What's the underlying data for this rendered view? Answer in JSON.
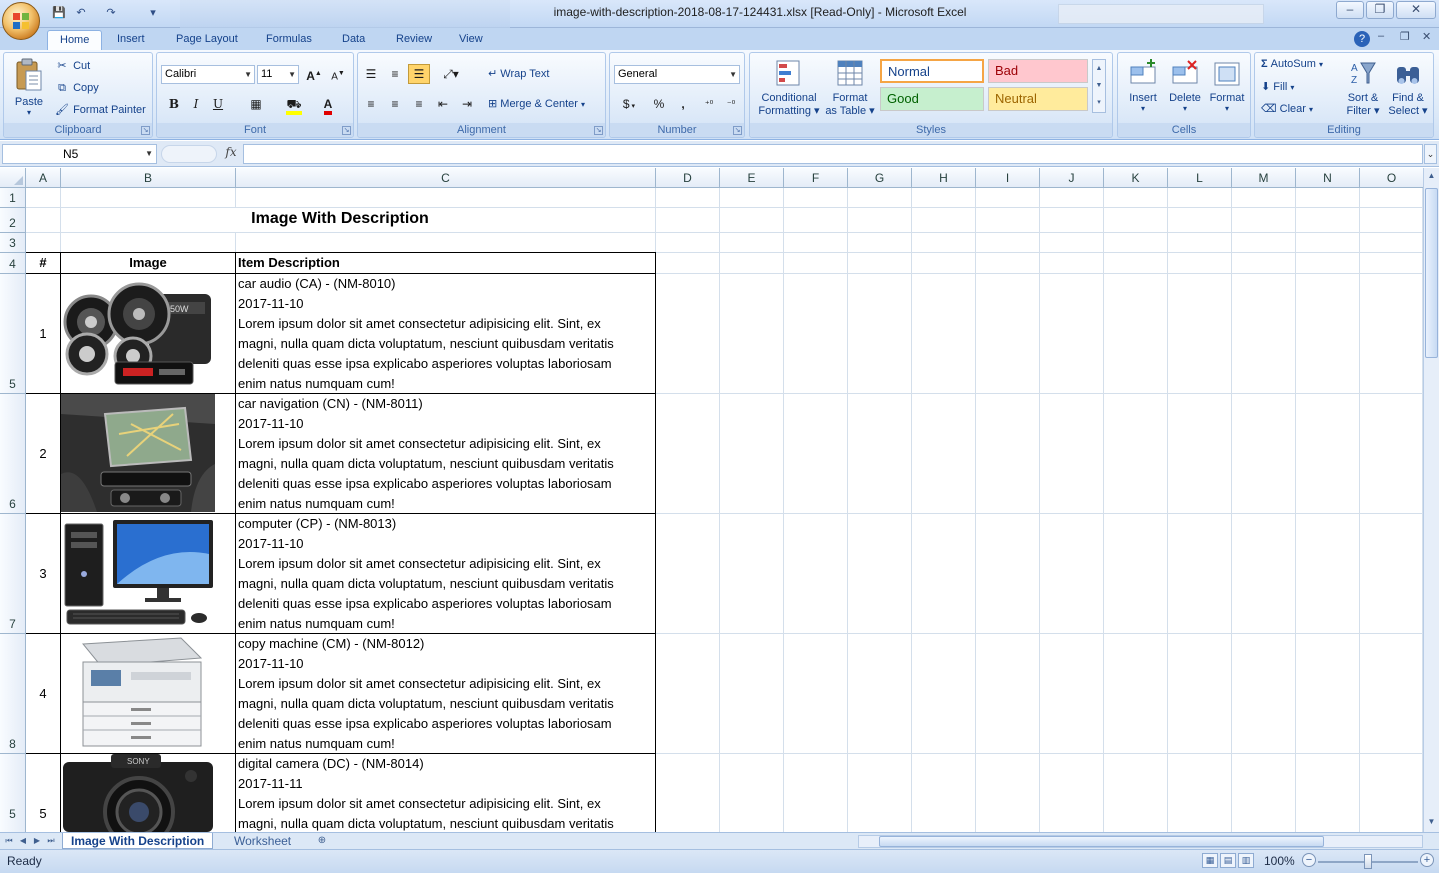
{
  "window": {
    "title": "image-with-description-2018-08-17-124431.xlsx  [Read-Only]  - Microsoft Excel",
    "minimize": "–",
    "restore": "❐",
    "close": "✕"
  },
  "ribbon_tabs": [
    "Home",
    "Insert",
    "Page Layout",
    "Formulas",
    "Data",
    "Review",
    "View"
  ],
  "clipboard": {
    "paste": "Paste",
    "cut": "Cut",
    "copy": "Copy",
    "format_painter": "Format Painter",
    "label": "Clipboard"
  },
  "font": {
    "name": "Calibri",
    "size": "11",
    "label": "Font",
    "bold": "B",
    "italic": "I",
    "underline": "U"
  },
  "alignment": {
    "wrap_text": "Wrap Text",
    "merge_center": "Merge & Center",
    "label": "Alignment"
  },
  "number": {
    "format": "General",
    "currency": "$",
    "percent": "%",
    "comma": ",",
    "label": "Number"
  },
  "styles": {
    "conditional_line1": "Conditional",
    "conditional_line2": "Formatting",
    "table_line1": "Format",
    "table_line2": "as Table",
    "normal": "Normal",
    "bad": "Bad",
    "good": "Good",
    "neutral": "Neutral",
    "label": "Styles",
    "normal_bg": "#ffffff",
    "bad_bg": "#ffc7ce",
    "good_bg": "#c6efce",
    "neutral_bg": "#ffeb9c",
    "bad_fg": "#9c0006",
    "good_fg": "#006100",
    "neutral_fg": "#9c6500"
  },
  "cells": {
    "insert": "Insert",
    "delete": "Delete",
    "format": "Format",
    "label": "Cells"
  },
  "editing": {
    "autosum": "AutoSum",
    "fill": "Fill",
    "clear": "Clear",
    "sort_line1": "Sort &",
    "sort_line2": "Filter",
    "find_line1": "Find &",
    "find_line2": "Select",
    "label": "Editing"
  },
  "formula_bar": {
    "name_box": "N5",
    "fx": "fx",
    "formula": ""
  },
  "columns": [
    "A",
    "B",
    "C",
    "D",
    "E",
    "F",
    "G",
    "H",
    "I",
    "J",
    "K",
    "L",
    "M",
    "N",
    "O"
  ],
  "rows": [
    "1",
    "2",
    "3",
    "4",
    "5",
    "6",
    "7",
    "8",
    "5"
  ],
  "sheet": {
    "title": "Image With Description",
    "headers": {
      "num": "#",
      "image": "Image",
      "desc": "Item Description"
    },
    "items": [
      {
        "num": "1",
        "name": "car audio (CA) - (NM-8010)",
        "date": "2017-11-10",
        "image": "car-audio-image",
        "l1": "Lorem ipsum dolor sit amet consectetur adipisicing elit. Sint, ex",
        "l2": "magni, nulla quam dicta voluptatum, nesciunt quibusdam veritatis",
        "l3": "deleniti quas esse ipsa explicabo asperiores voluptas laboriosam",
        "l4": "enim natus numquam cum!"
      },
      {
        "num": "2",
        "name": "car navigation (CN) - (NM-8011)",
        "date": "2017-11-10",
        "image": "car-navigation-image",
        "l1": "Lorem ipsum dolor sit amet consectetur adipisicing elit. Sint, ex",
        "l2": "magni, nulla quam dicta voluptatum, nesciunt quibusdam veritatis",
        "l3": "deleniti quas esse ipsa explicabo asperiores voluptas laboriosam",
        "l4": "enim natus numquam cum!"
      },
      {
        "num": "3",
        "name": "computer (CP) - (NM-8013)",
        "date": "2017-11-10",
        "image": "computer-image",
        "l1": "Lorem ipsum dolor sit amet consectetur adipisicing elit. Sint, ex",
        "l2": "magni, nulla quam dicta voluptatum, nesciunt quibusdam veritatis",
        "l3": "deleniti quas esse ipsa explicabo asperiores voluptas laboriosam",
        "l4": "enim natus numquam cum!"
      },
      {
        "num": "4",
        "name": "copy machine (CM) - (NM-8012)",
        "date": "2017-11-10",
        "image": "copy-machine-image",
        "l1": "Lorem ipsum dolor sit amet consectetur adipisicing elit. Sint, ex",
        "l2": "magni, nulla quam dicta voluptatum, nesciunt quibusdam veritatis",
        "l3": "deleniti quas esse ipsa explicabo asperiores voluptas laboriosam",
        "l4": "enim natus numquam cum!"
      },
      {
        "num": "5",
        "name": "digital camera (DC) - (NM-8014)",
        "date": "2017-11-11",
        "image": "digital-camera-image",
        "l1": "Lorem ipsum dolor sit amet consectetur adipisicing elit. Sint, ex",
        "l2": "magni, nulla quam dicta voluptatum, nesciunt quibusdam veritatis",
        "l3": "",
        "l4": ""
      }
    ]
  },
  "sheet_tabs": [
    "Image With Description",
    "Worksheet"
  ],
  "status": {
    "ready": "Ready",
    "zoom": "100%"
  }
}
